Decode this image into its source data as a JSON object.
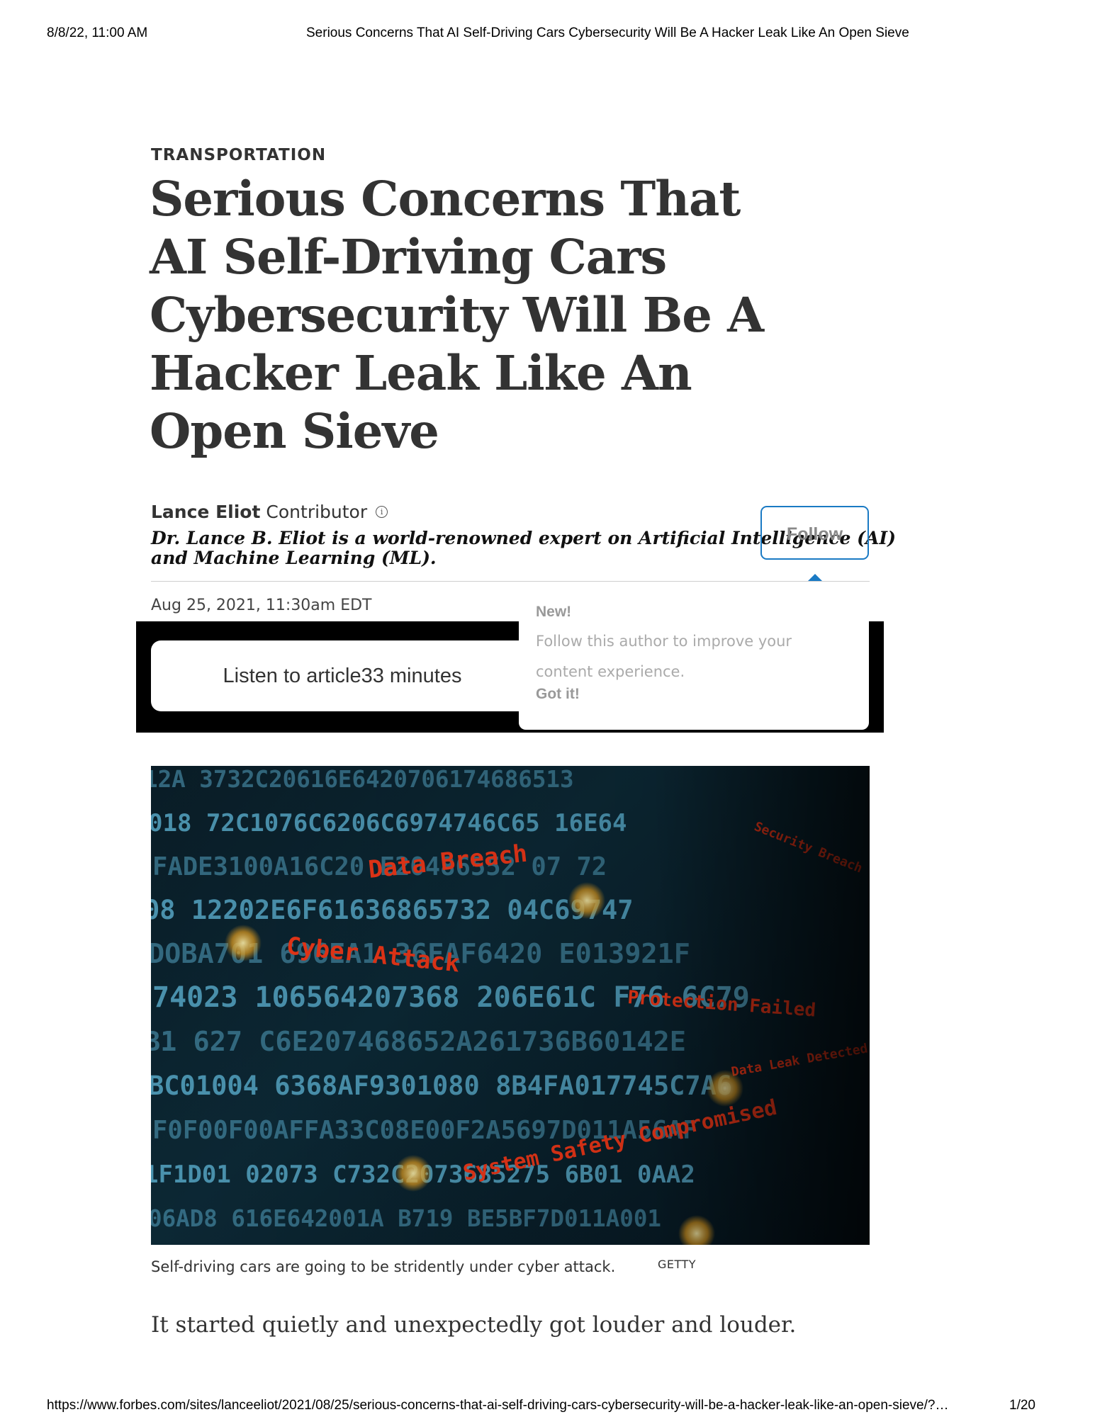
{
  "print_header": {
    "date": "8/8/22, 11:00 AM",
    "title": "Serious Concerns That AI Self-Driving Cars Cybersecurity Will Be A Hacker Leak Like An Open Sieve"
  },
  "article": {
    "section": "TRANSPORTATION",
    "headline": "Serious Concerns That AI Self-Driving Cars Cybersecurity Will Be A Hacker Leak Like An Open Sieve",
    "author_name": "Lance Eliot",
    "author_role": "Contributor",
    "author_bio": "Dr. Lance B. Eliot is a world-renowned expert on Artificial Intelligence (AI) and Machine Learning (ML).",
    "follow_label": "Follow",
    "published": "Aug 25, 2021, 11:30am EDT",
    "listen_label": "Listen to article33 minutes",
    "image_caption": "Self-driving cars are going to be stridently under cyber attack.",
    "image_credit": "GETTY",
    "lead_paragraph": "It started quietly and unexpectedly got louder and louder."
  },
  "follow_popup": {
    "new_label": "New!",
    "message": "Follow this author to improve your content experience.",
    "dismiss_label": "Got it!"
  },
  "hero_image": {
    "alert_labels": [
      "Data Breach",
      "Cyber Attack",
      "Protection Failed",
      "System Safety Compromised",
      "Data Leak Detected",
      "Security Breach"
    ],
    "hex_rows": [
      "12A  3732C20616E6420706174686513",
      "018 72C1076C6206C6974746C65 16E64",
      "FADE3100A16C20 E20486552 07 72",
      "08 12202E6F61636865732 04C69747",
      "DOBA701 696EA1 36FAF6420 E013921F",
      "74023 106564207368 206E61C F76 6C79",
      "B1 627 C6E207468652A261736B60142E",
      "BC01004 6368AF9301080 8B4FA017745C7A6",
      "F0F00F00AFFA33C08E00F2A5697D011A56AF",
      "1F1D01 02073 C732C2073685275 6B01 0AA2",
      "06AD8 616E642001A B719 BE5BF7D011A001"
    ],
    "colors": {
      "alert": "#ff3b1a",
      "hex": "#5fb7d9",
      "glow": "#ffb020"
    }
  },
  "print_footer": {
    "url": "https://www.forbes.com/sites/lanceeliot/2021/08/25/serious-concerns-that-ai-self-driving-cars-cybersecurity-will-be-a-hacker-leak-like-an-open-sieve/?…",
    "page": "1/20"
  }
}
